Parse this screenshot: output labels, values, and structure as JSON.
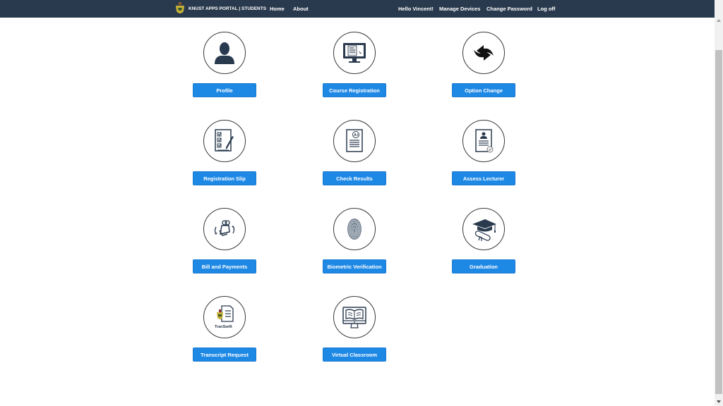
{
  "navbar": {
    "brand": "KNUST APPS PORTAL | STUDENTS",
    "logo_icon": "knust-crest-icon",
    "left_links": [
      "Home",
      "About"
    ],
    "right_links": [
      "Hello Vincent!",
      "Manage Devices",
      "Change Password",
      "Log off"
    ]
  },
  "tiles": [
    {
      "label": "Profile",
      "icon": "user-silhouette-icon"
    },
    {
      "label": "Course Registration",
      "icon": "monitor-document-icon"
    },
    {
      "label": "Option Change",
      "icon": "swap-arrows-icon"
    },
    {
      "label": "Registration Slip",
      "icon": "checklist-pen-icon"
    },
    {
      "label": "Check Results",
      "icon": "grade-document-icon"
    },
    {
      "label": "Assess Lecturer",
      "icon": "profile-document-check-icon"
    },
    {
      "label": "Bill and Payments",
      "icon": "money-bag-hand-icon"
    },
    {
      "label": "Biometric Verification",
      "icon": "fingerprint-icon"
    },
    {
      "label": "Graduation",
      "icon": "graduation-cap-diploma-icon"
    },
    {
      "label": "Transcript Request",
      "icon": "transwift-document-icon",
      "icon_text": "TranSwift"
    },
    {
      "label": "Virtual Classroom",
      "icon": "monitor-book-icon"
    }
  ]
}
